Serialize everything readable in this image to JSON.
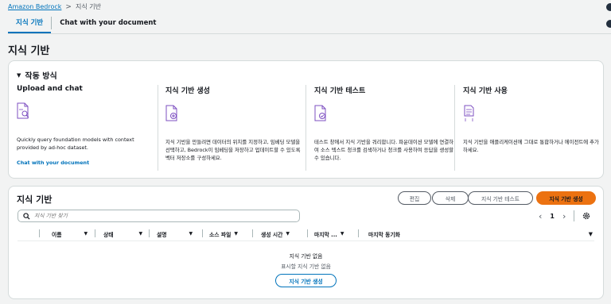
{
  "breadcrumb": {
    "root": "Amazon Bedrock",
    "separator": ">",
    "current": "지식 기반"
  },
  "tabs": [
    {
      "label": "지식 기반",
      "active": true
    },
    {
      "label": "Chat with your document",
      "active": false
    }
  ],
  "page_title": "지식 기반",
  "how_it_works": {
    "title": "작동 방식",
    "columns": [
      {
        "title": "Upload and chat",
        "icon": "document-search-icon",
        "desc": "Quickly query foundation models with context provided by ad-hoc dataset.",
        "link": "Chat with your document"
      },
      {
        "title": "지식 기반 생성",
        "icon": "document-add-icon",
        "desc": "지식 기반을 만들려면 데이터의 위치를 지정하고, 임베딩 모델을 선택하고, Bedrock이 임베딩을 저장하고 업데이트할 수 있도록 벡터 저장소를 구성하세요.",
        "link": ""
      },
      {
        "title": "지식 기반 테스트",
        "icon": "document-check-icon",
        "desc": "테스트 창에서 지식 기반을 쿼리합니다. 파운데이션 모델에 연결하여 소스 텍스트 청크를 검색하거나 청크를 사용하여 응답을 생성할 수 있습니다.",
        "link": ""
      },
      {
        "title": "지식 기반 사용",
        "icon": "document-use-icon",
        "desc": "지식 기반을 애플리케이션에 그대로 통합하거나 에이전트에 추가하세요.",
        "link": ""
      }
    ]
  },
  "kb_table": {
    "title": "지식 기반",
    "buttons": {
      "edit": "편집",
      "delete": "삭제",
      "test": "지식 기반 테스트",
      "create": "지식 기반 생성"
    },
    "search_placeholder": "지식 기반 찾기",
    "page": "1",
    "columns": [
      "이름",
      "상태",
      "설명",
      "소스 파일",
      "생성 시간",
      "마지막 ...",
      "마지막 동기화"
    ],
    "empty_title": "지식 기반 없음",
    "empty_sub": "표시할 지식 기반 없음",
    "empty_button": "지식 기반 생성"
  },
  "colors": {
    "link": "#0073bb",
    "primary": "#ec7211",
    "icon": "#7d4fc1"
  }
}
